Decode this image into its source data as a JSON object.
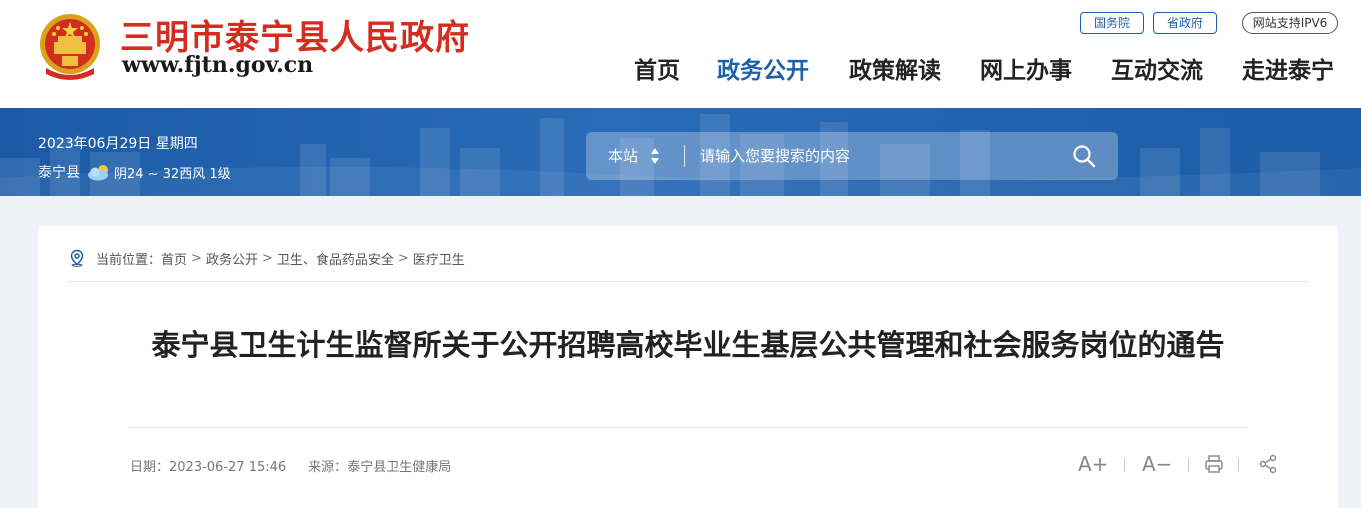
{
  "header": {
    "site_title": "三明市泰宁县人民政府",
    "site_url": "www.fjtn.gov.cn",
    "top_links": [
      "国务院",
      "省政府"
    ],
    "ipv6_badge": "网站支持IPV6",
    "nav": [
      "首页",
      "政务公开",
      "政策解读",
      "网上办事",
      "互动交流",
      "走进泰宁"
    ],
    "active_nav": "政务公开"
  },
  "banner": {
    "date": "2023年06月29日  星期四",
    "city": "泰宁县",
    "weather": "阴24 ~ 32西风 1级",
    "weather_icon": "cloudy-icon",
    "search": {
      "scope": "本站",
      "placeholder": "请输入您要搜索的内容"
    }
  },
  "breadcrumb": {
    "label": "当前位置：",
    "items": [
      "首页",
      "政务公开",
      "卫生、食品药品安全",
      "医疗卫生"
    ]
  },
  "article": {
    "title": "泰宁县卫生计生监督所关于公开招聘高校毕业生基层公共管理和社会服务岗位的通告",
    "date_label": "日期：",
    "date": "2023-06-27 15:46",
    "source_label": "来源：",
    "source": "泰宁县卫生健康局"
  },
  "tools": {
    "font_larger": "A+",
    "font_smaller": "A−",
    "print_icon": "print-icon",
    "share_icon": "share-icon"
  },
  "colors": {
    "brand_red": "#d42d1f",
    "brand_blue": "#1f5fa8",
    "banner_blue": "#1a5aa6"
  }
}
